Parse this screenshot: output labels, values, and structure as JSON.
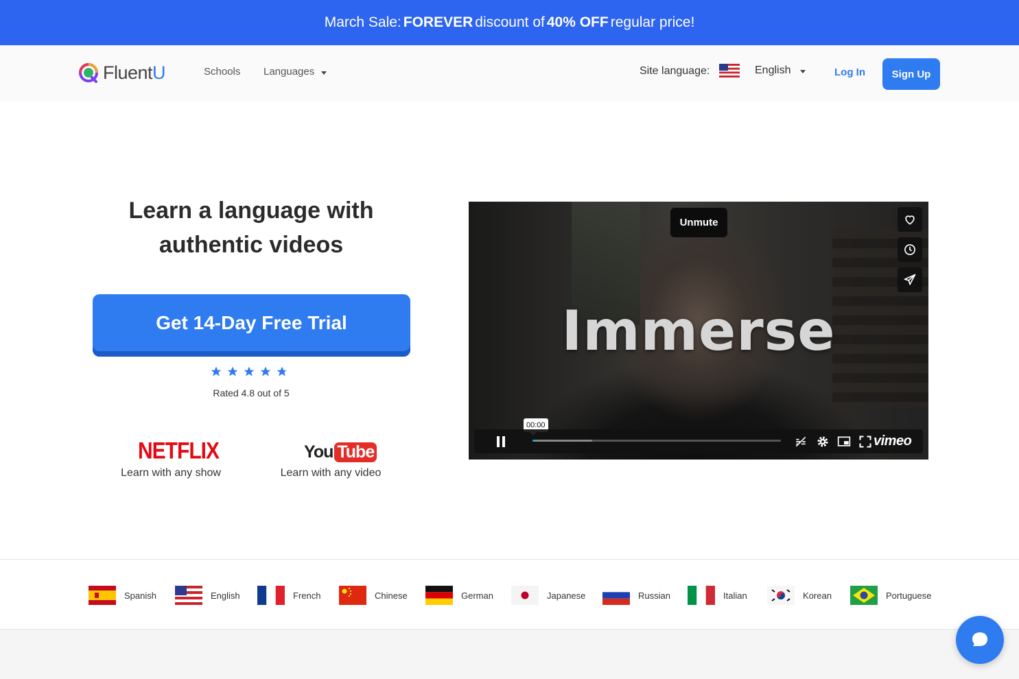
{
  "promo": {
    "part1": "March Sale:",
    "part2": "FOREVER",
    "part3": "discount of",
    "part4": "40% OFF",
    "part5": "regular price!",
    "color": "#2d64f0"
  },
  "header": {
    "logo_text_a": "Fluent",
    "logo_text_b": "U",
    "nav": {
      "schools": "Schools",
      "languages": "Languages"
    },
    "site_language_label": "Site language:",
    "site_language_value": "English",
    "login": "Log In",
    "signup": "Sign Up",
    "accent": "#2f7bf0"
  },
  "hero": {
    "title_line1": "Learn a language with",
    "title_line2": "authentic videos",
    "cta": "Get 14-Day Free Trial",
    "rating_stars": 5,
    "rating_text": "Rated 4.8 out of 5",
    "brands": [
      {
        "logo": "NETFLIX",
        "caption": "Learn with any show"
      },
      {
        "logo_you": "You",
        "logo_tube": "Tube",
        "caption": "Learn with any video"
      }
    ]
  },
  "video": {
    "overlay_text": "Immerse",
    "unmute": "Unmute",
    "timecode": "00:00",
    "progress_played": 0.01,
    "progress_loaded": 0.24,
    "provider": "vimeo",
    "side_icons": [
      "heart-icon",
      "clock-icon",
      "send-icon"
    ],
    "control_icons": [
      "pause-icon",
      "captions-off-icon",
      "settings-icon",
      "pip-icon",
      "fullscreen-icon"
    ]
  },
  "languages": [
    {
      "name": "Spanish",
      "flag": "es"
    },
    {
      "name": "English",
      "flag": "us"
    },
    {
      "name": "French",
      "flag": "fr"
    },
    {
      "name": "Chinese",
      "flag": "cn"
    },
    {
      "name": "German",
      "flag": "de"
    },
    {
      "name": "Japanese",
      "flag": "jp"
    },
    {
      "name": "Russian",
      "flag": "ru"
    },
    {
      "name": "Italian",
      "flag": "it"
    },
    {
      "name": "Korean",
      "flag": "kr"
    },
    {
      "name": "Portuguese",
      "flag": "br"
    }
  ],
  "chat": {
    "icon": "chat-bubble-icon"
  }
}
